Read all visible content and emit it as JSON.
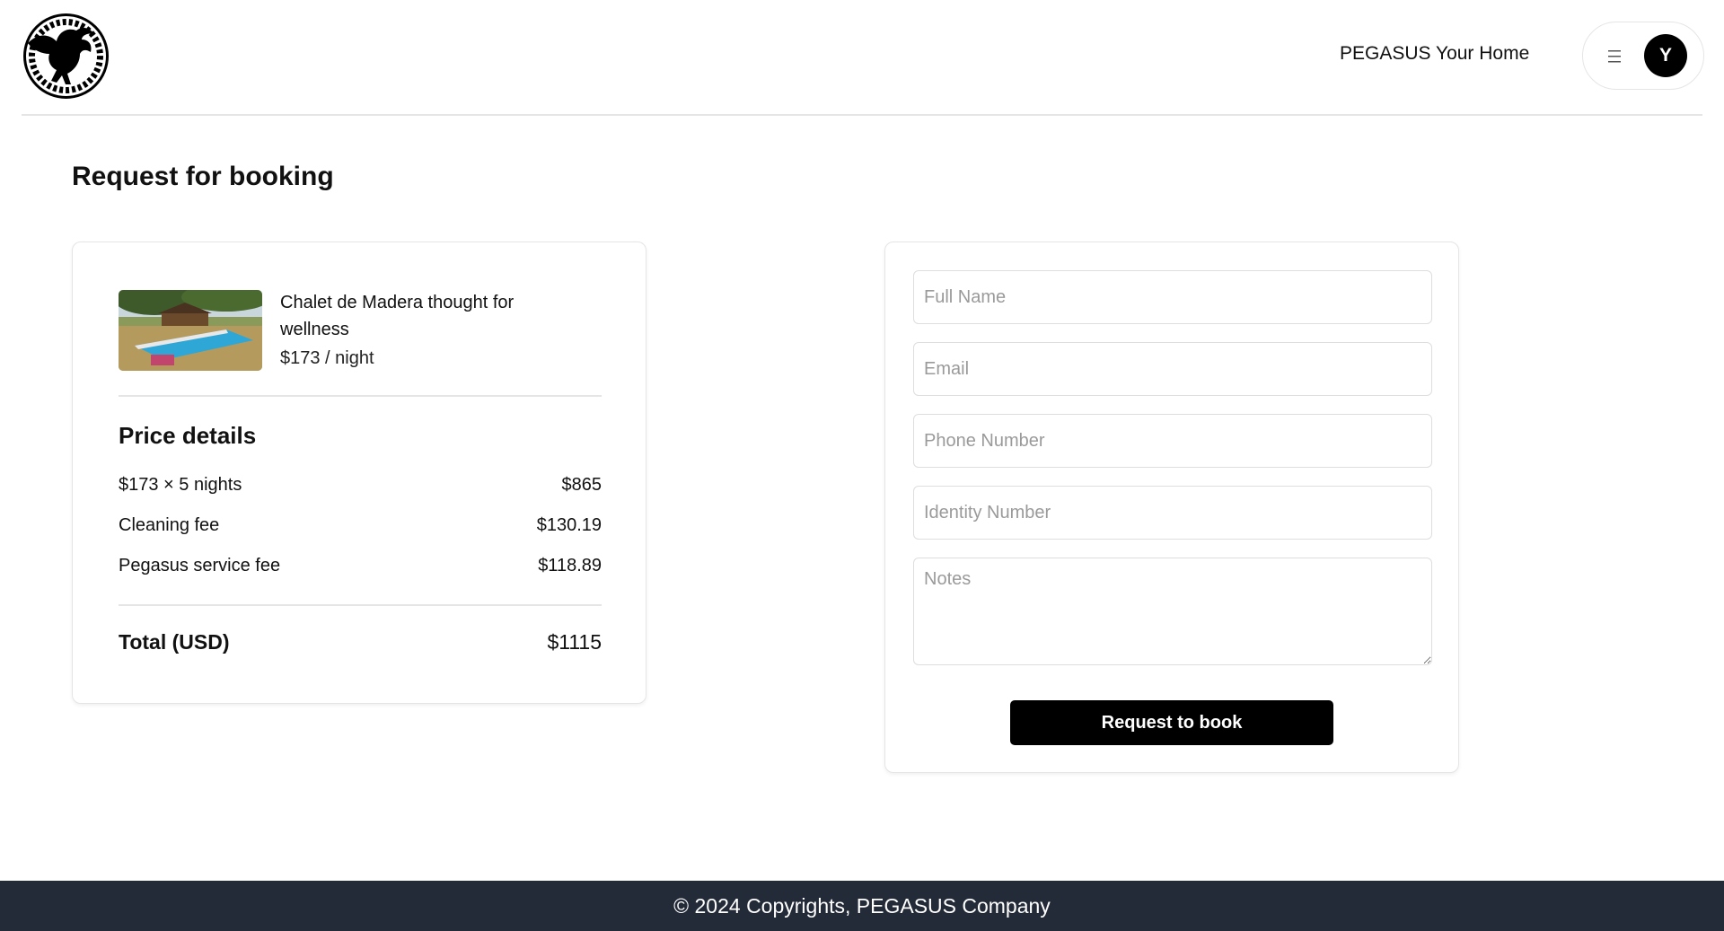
{
  "header": {
    "logo_icon": "pegasus-logo-icon",
    "brand_text": "PEGASUS Your Home",
    "menu_icon": "hamburger-menu-icon",
    "avatar_initial": "Y"
  },
  "page": {
    "title": "Request for booking"
  },
  "listing": {
    "name": "Chalet de Madera thought for wellness",
    "price_per_night": "$173 / night",
    "thumbnail": "chalet-pool-photo"
  },
  "price_details": {
    "heading": "Price details",
    "rows": [
      {
        "label": "$173 × 5 nights",
        "value": "$865"
      },
      {
        "label": "Cleaning fee",
        "value": "$130.19"
      },
      {
        "label": "Pegasus service fee",
        "value": "$118.89"
      }
    ],
    "total": {
      "label": "Total (USD)",
      "value": "$1115"
    }
  },
  "form": {
    "full_name": {
      "placeholder": "Full Name",
      "value": ""
    },
    "email": {
      "placeholder": "Email",
      "value": ""
    },
    "phone": {
      "placeholder": "Phone Number",
      "value": ""
    },
    "identity": {
      "placeholder": "Identity Number",
      "value": ""
    },
    "notes": {
      "placeholder": "Notes",
      "value": ""
    },
    "submit_label": "Request to book"
  },
  "footer": {
    "copyright_icon": "copyright-icon",
    "text": "© 2024 Copyrights, PEGASUS Company"
  },
  "colors": {
    "footer_bg": "#232a38",
    "button_bg": "#000000",
    "border": "#e5e5e5"
  }
}
